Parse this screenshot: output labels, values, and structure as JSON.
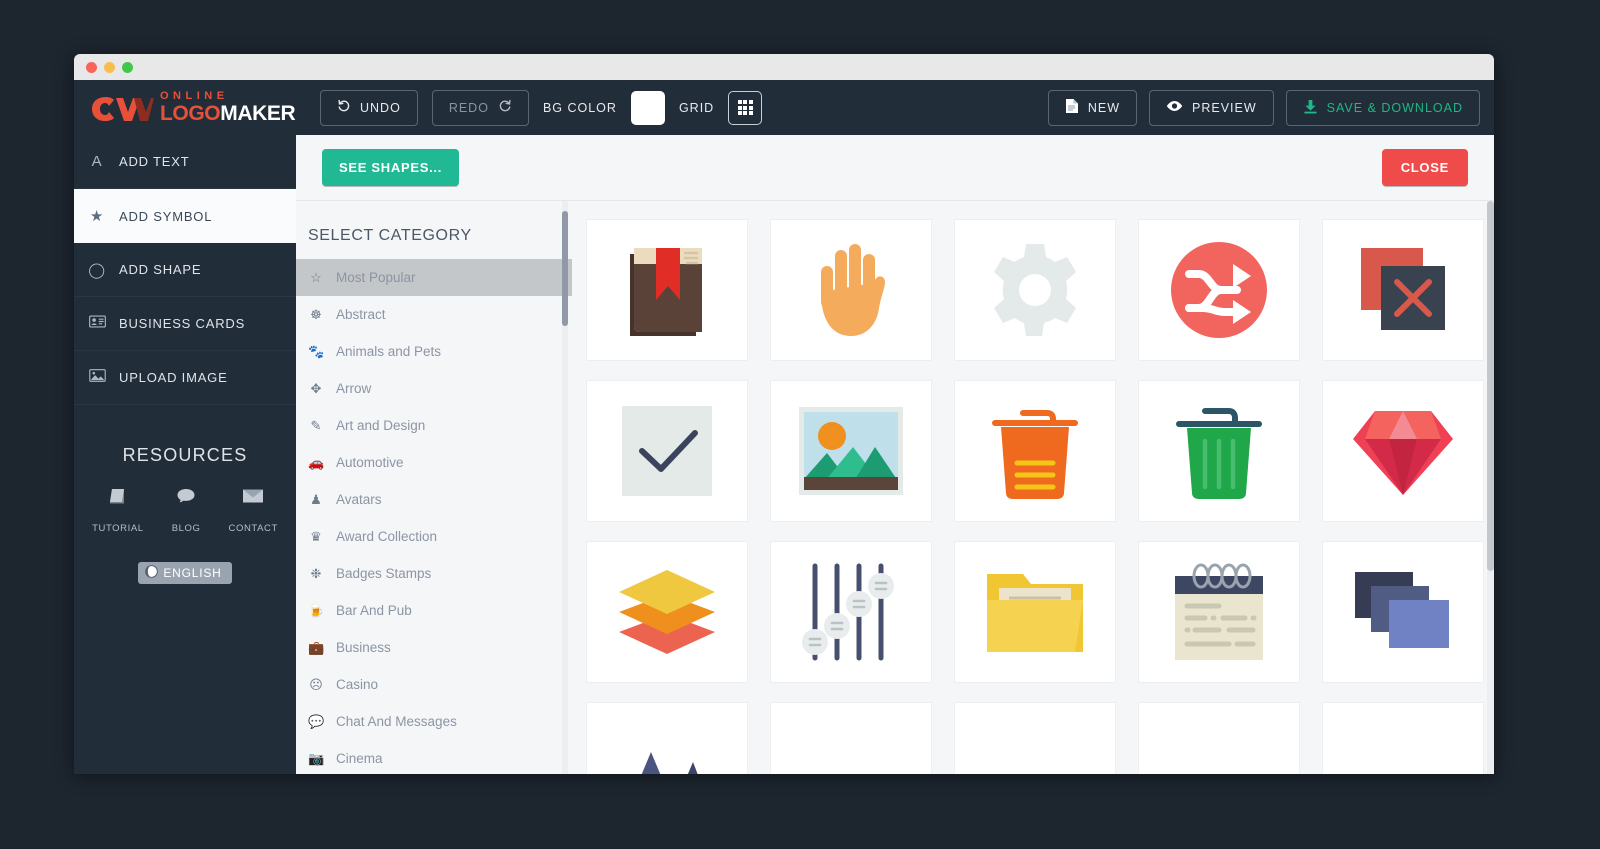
{
  "window": {
    "traffic_lights": [
      "close",
      "minimize",
      "zoom"
    ]
  },
  "brand": {
    "online": "ONLINE",
    "logo": "LOGOMAKER",
    "logo_prefix": "LOGO",
    "logo_suffix": "MAKER"
  },
  "toolbar": {
    "undo_label": "UNDO",
    "undo_icon": "undo-icon",
    "redo_label": "REDO",
    "redo_icon": "redo-icon",
    "bg_color_label": "BG COLOR",
    "bg_color_value": "#ffffff",
    "grid_label": "GRID",
    "grid_icon": "grid-icon",
    "new_label": "NEW",
    "new_icon": "document-icon",
    "preview_label": "PREVIEW",
    "preview_icon": "eye-icon",
    "save_label": "SAVE & DOWNLOAD",
    "save_icon": "download-icon",
    "accent_color": "#1fb784"
  },
  "sidebar": {
    "items": [
      {
        "label": "ADD TEXT",
        "icon": "text-a-icon",
        "active": false
      },
      {
        "label": "ADD SYMBOL",
        "icon": "star-icon",
        "active": true
      },
      {
        "label": "ADD SHAPE",
        "icon": "circle-icon",
        "active": false
      },
      {
        "label": "BUSINESS CARDS",
        "icon": "id-card-icon",
        "active": false
      },
      {
        "label": "UPLOAD IMAGE",
        "icon": "image-icon",
        "active": false
      }
    ],
    "resources": {
      "title": "RESOURCES",
      "links": [
        {
          "label": "TUTORIAL",
          "icon": "book-icon"
        },
        {
          "label": "BLOG",
          "icon": "comment-icon"
        },
        {
          "label": "CONTACT",
          "icon": "envelope-icon"
        }
      ],
      "language": {
        "label": "ENGLISH",
        "icon": "globe-icon"
      }
    }
  },
  "panel": {
    "see_shapes_label": "SEE SHAPES...",
    "close_label": "CLOSE",
    "categories_title": "SELECT CATEGORY",
    "categories": [
      {
        "label": "Most Popular",
        "icon": "star-outline-icon",
        "selected": true
      },
      {
        "label": "Abstract",
        "icon": "abstract-icon",
        "selected": false
      },
      {
        "label": "Animals and Pets",
        "icon": "paw-icon",
        "selected": false
      },
      {
        "label": "Arrow",
        "icon": "arrows-icon",
        "selected": false
      },
      {
        "label": "Art and Design",
        "icon": "brush-icon",
        "selected": false
      },
      {
        "label": "Automotive",
        "icon": "car-icon",
        "selected": false
      },
      {
        "label": "Avatars",
        "icon": "person-icon",
        "selected": false
      },
      {
        "label": "Award Collection",
        "icon": "trophy-icon",
        "selected": false
      },
      {
        "label": "Badges Stamps",
        "icon": "badge-icon",
        "selected": false
      },
      {
        "label": "Bar And Pub",
        "icon": "beer-icon",
        "selected": false
      },
      {
        "label": "Business",
        "icon": "briefcase-icon",
        "selected": false
      },
      {
        "label": "Casino",
        "icon": "casino-icon",
        "selected": false
      },
      {
        "label": "Chat And Messages",
        "icon": "chat-icon",
        "selected": false
      },
      {
        "label": "Cinema",
        "icon": "camera-icon",
        "selected": false
      }
    ],
    "symbols": [
      {
        "name": "book-bookmark-symbol",
        "colors": [
          "#5b4239",
          "#ebdcc0",
          "#e02d26"
        ]
      },
      {
        "name": "hand-palm-symbol",
        "colors": [
          "#f4ac5c"
        ]
      },
      {
        "name": "gear-symbol",
        "colors": [
          "#e4e9e9"
        ]
      },
      {
        "name": "shuffle-arrows-symbol",
        "colors": [
          "#f2655f",
          "#ffffff"
        ]
      },
      {
        "name": "close-window-symbol",
        "colors": [
          "#d8584c",
          "#39434f"
        ]
      },
      {
        "name": "checkmark-symbol",
        "colors": [
          "#e4eae8",
          "#3b445c"
        ]
      },
      {
        "name": "picture-landscape-symbol",
        "colors": [
          "#bfdfeb",
          "#f0901e",
          "#21a97a",
          "#5b4439"
        ]
      },
      {
        "name": "trash-orange-symbol",
        "colors": [
          "#ef6a1e",
          "#f5c518"
        ]
      },
      {
        "name": "trash-green-symbol",
        "colors": [
          "#1fa74a",
          "#2c5666"
        ]
      },
      {
        "name": "diamond-symbol",
        "colors": [
          "#ef4056",
          "#d32a4a",
          "#f28b93"
        ]
      },
      {
        "name": "layers-symbol",
        "colors": [
          "#efc840",
          "#ef8f1e",
          "#ec6450"
        ]
      },
      {
        "name": "sliders-symbol",
        "colors": [
          "#46506e",
          "#e8ecec"
        ]
      },
      {
        "name": "folder-open-symbol",
        "colors": [
          "#f0c633",
          "#ece3cd"
        ]
      },
      {
        "name": "notebook-symbol",
        "colors": [
          "#3e4762",
          "#eae5cf",
          "#c9c8b2"
        ]
      },
      {
        "name": "windows-stack-symbol",
        "colors": [
          "#363c54",
          "#515c85",
          "#7082c4"
        ]
      },
      {
        "name": "mountain-symbol",
        "colors": [
          "#4a5480"
        ]
      },
      {
        "name": "blank-symbol",
        "colors": [
          "#ffffff"
        ]
      },
      {
        "name": "desk-symbol",
        "colors": [
          "#39434f"
        ]
      },
      {
        "name": "box-symbol",
        "colors": [
          "#b6803f"
        ]
      },
      {
        "name": "circle-orange-symbol",
        "colors": [
          "#efa73a"
        ]
      }
    ]
  }
}
